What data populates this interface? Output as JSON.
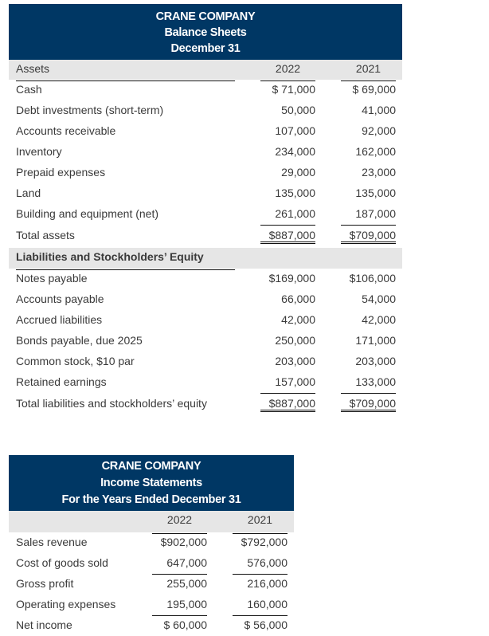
{
  "balance_sheet": {
    "company": "CRANE COMPANY",
    "title": "Balance Sheets",
    "date": "December 31",
    "years": [
      "2022",
      "2021"
    ],
    "assets_header": "Assets",
    "assets": [
      {
        "label": "Cash",
        "y2022": "$ 71,000",
        "y2021": "$ 69,000"
      },
      {
        "label": "Debt investments (short-term)",
        "y2022": "50,000",
        "y2021": "41,000"
      },
      {
        "label": "Accounts receivable",
        "y2022": "107,000",
        "y2021": "92,000"
      },
      {
        "label": "Inventory",
        "y2022": "234,000",
        "y2021": "162,000"
      },
      {
        "label": "Prepaid expenses",
        "y2022": "29,000",
        "y2021": "23,000"
      },
      {
        "label": "Land",
        "y2022": "135,000",
        "y2021": "135,000"
      },
      {
        "label": "Building and equipment (net)",
        "y2022": "261,000",
        "y2021": "187,000"
      },
      {
        "label": "Total assets",
        "y2022": "$887,000",
        "y2021": "$709,000"
      }
    ],
    "liabilities_header": "Liabilities and Stockholders’ Equity",
    "liabilities": [
      {
        "label": "Notes payable",
        "y2022": "$169,000",
        "y2021": "$106,000"
      },
      {
        "label": "Accounts payable",
        "y2022": "66,000",
        "y2021": "54,000"
      },
      {
        "label": "Accrued liabilities",
        "y2022": "42,000",
        "y2021": "42,000"
      },
      {
        "label": "Bonds payable, due 2025",
        "y2022": "250,000",
        "y2021": "171,000"
      },
      {
        "label": "Common stock, $10 par",
        "y2022": "203,000",
        "y2021": "203,000"
      },
      {
        "label": "Retained earnings",
        "y2022": "157,000",
        "y2021": "133,000"
      },
      {
        "label": "Total liabilities and stockholders’ equity",
        "y2022": "$887,000",
        "y2021": "$709,000"
      }
    ]
  },
  "income_statement": {
    "company": "CRANE COMPANY",
    "title": "Income Statements",
    "period": "For the Years Ended December 31",
    "years": [
      "2022",
      "2021"
    ],
    "rows": [
      {
        "label": "Sales revenue",
        "y2022": "$902,000",
        "y2021": "$792,000"
      },
      {
        "label": "Cost of goods sold",
        "y2022": "647,000",
        "y2021": "576,000"
      },
      {
        "label": "Gross profit",
        "y2022": "255,000",
        "y2021": "216,000"
      },
      {
        "label": "Operating expenses",
        "y2022": "195,000",
        "y2021": "160,000"
      },
      {
        "label": "Net income",
        "y2022": "$ 60,000",
        "y2021": "$ 56,000"
      }
    ]
  }
}
